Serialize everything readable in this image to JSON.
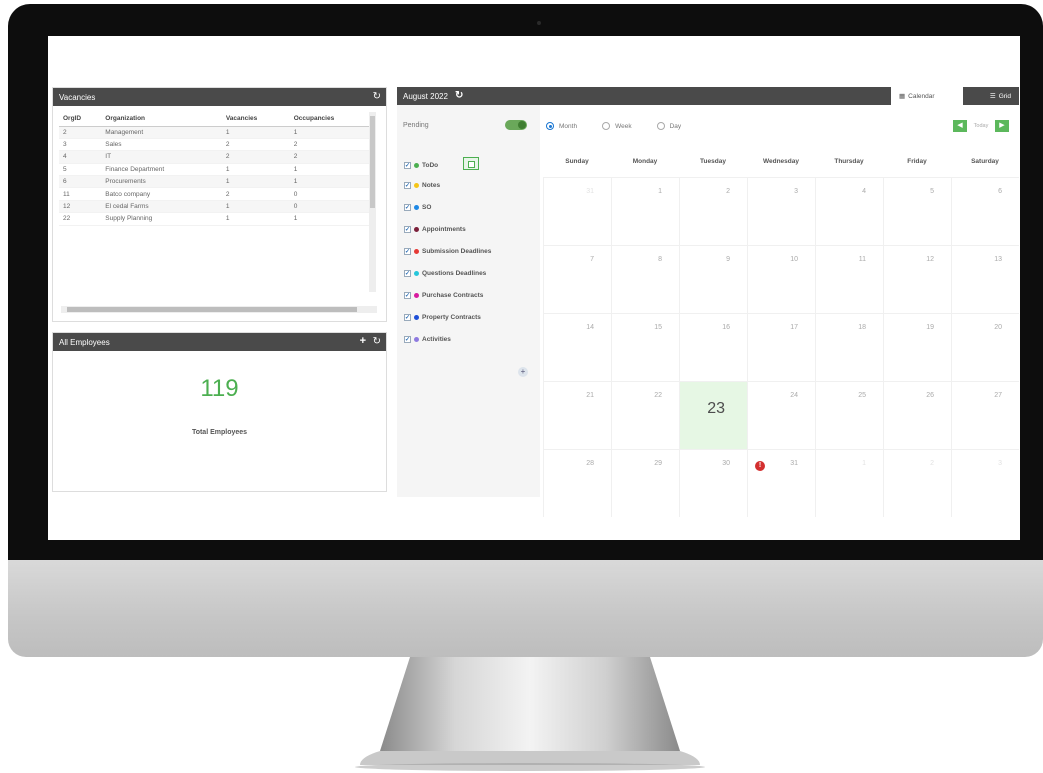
{
  "vacancies": {
    "title": "Vacancies",
    "columns": [
      "OrgID",
      "Organization",
      "Vacancies",
      "Occupancies"
    ],
    "rows": [
      [
        "2",
        "Management",
        "1",
        "1"
      ],
      [
        "3",
        "Sales",
        "2",
        "2"
      ],
      [
        "4",
        "IT",
        "2",
        "2"
      ],
      [
        "5",
        "Finance Department",
        "1",
        "1"
      ],
      [
        "6",
        "Procurements",
        "1",
        "1"
      ],
      [
        "11",
        "Batco company",
        "2",
        "0"
      ],
      [
        "12",
        "El cedal Farms",
        "1",
        "0"
      ],
      [
        "22",
        "Supply Planning",
        "1",
        "1"
      ]
    ]
  },
  "employees": {
    "title": "All Employees",
    "count": "119",
    "label": "Total Employees"
  },
  "calendar": {
    "title": "August 2022",
    "tab_calendar": "Calendar",
    "tab_grid": "Grid",
    "pending_label": "Pending",
    "views": [
      "Month",
      "Week",
      "Day"
    ],
    "today_label": "Today",
    "weekdays": [
      "Sunday",
      "Monday",
      "Tuesday",
      "Wednesday",
      "Thursday",
      "Friday",
      "Saturday"
    ],
    "weeks": [
      [
        "31",
        "1",
        "2",
        "3",
        "4",
        "5",
        "6"
      ],
      [
        "7",
        "8",
        "9",
        "10",
        "11",
        "12",
        "13"
      ],
      [
        "14",
        "15",
        "16",
        "17",
        "18",
        "19",
        "20"
      ],
      [
        "21",
        "22",
        "23",
        "24",
        "25",
        "26",
        "27"
      ],
      [
        "28",
        "29",
        "30",
        "31",
        "1",
        "2",
        "3"
      ]
    ],
    "filters": [
      {
        "label": "ToDo",
        "color": "#4caf50"
      },
      {
        "label": "Notes",
        "color": "#f5c518"
      },
      {
        "label": "SO",
        "color": "#1e88e5"
      },
      {
        "label": "Appointments",
        "color": "#7b1f3a"
      },
      {
        "label": "Submission Deadlines",
        "color": "#e53935"
      },
      {
        "label": "Questions Deadlines",
        "color": "#26c6da"
      },
      {
        "label": "Purchase Contracts",
        "color": "#d81b9f"
      },
      {
        "label": "Property Contracts",
        "color": "#1e4fd8"
      },
      {
        "label": "Activities",
        "color": "#8e7ae0"
      }
    ]
  },
  "colors": {
    "header_bg": "#4a4a4a",
    "accent_green": "#4caf50",
    "today_bg": "#e6f7e4",
    "alert_red": "#d32f2f"
  },
  "icons": [
    "refresh-icon",
    "plus-icon",
    "calendar-icon",
    "grid-icon",
    "alert-icon",
    "checkbox-icon"
  ]
}
